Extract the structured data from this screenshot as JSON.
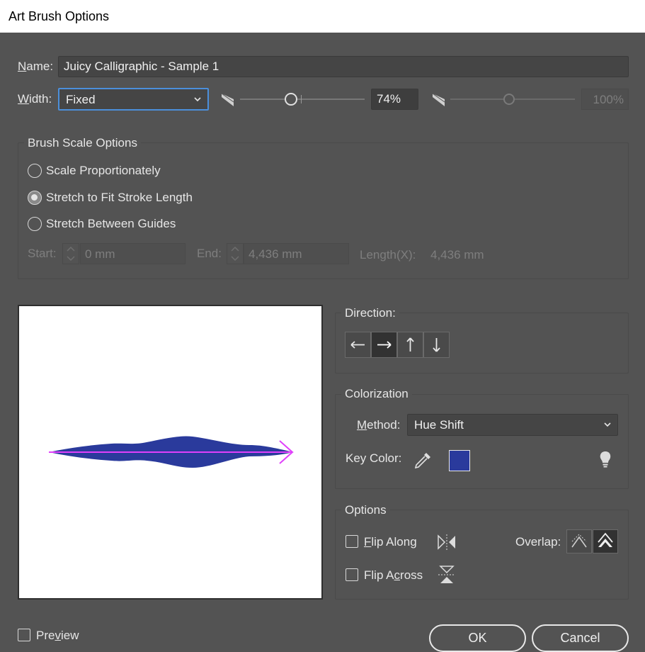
{
  "window": {
    "title": "Art Brush Options"
  },
  "name_row": {
    "label_prefix": "N",
    "label_rest": "ame:",
    "value": "Juicy Calligraphic - Sample 1"
  },
  "width_row": {
    "label_prefix": "W",
    "label_rest": "idth:",
    "select_value": "Fixed",
    "slider_value_text": "74%",
    "slider_fraction": 0.4,
    "max_value_text": "100%",
    "max_slider_fraction": 0.47
  },
  "scale_group": {
    "title": "Brush Scale Options",
    "options": [
      "Scale Proportionately",
      "Stretch to Fit Stroke Length",
      "Stretch Between Guides"
    ],
    "selected_index": 1,
    "start_label": "Start:",
    "start_value": "0 mm",
    "end_label": "End:",
    "end_value": "4,436 mm",
    "length_label": "Length(X):",
    "length_value": "4,436 mm"
  },
  "direction": {
    "title": "Direction:",
    "buttons": [
      "left-arrow",
      "right-arrow",
      "up-arrow",
      "down-arrow"
    ],
    "selected": "right-arrow"
  },
  "colorization": {
    "title": "Colorization",
    "method_label_prefix": "M",
    "method_label_rest": "ethod:",
    "method_value": "Hue Shift",
    "key_color_label": "Key Color:",
    "key_color": "#2a3a9c"
  },
  "options": {
    "title": "Options",
    "flip_along_prefix": "F",
    "flip_along_rest": "lip Along",
    "flip_across_start": "Flip A",
    "flip_across_u": "c",
    "flip_across_end": "ross",
    "overlap_label": "Overlap:"
  },
  "preview": {
    "label_start": "Pre",
    "label_u": "v",
    "label_end": "iew"
  },
  "buttons": {
    "ok": "OK",
    "cancel": "Cancel"
  },
  "colors": {
    "accent": "#4b8fdb",
    "brush": "#2a3a9c",
    "path": "#e040fb"
  }
}
